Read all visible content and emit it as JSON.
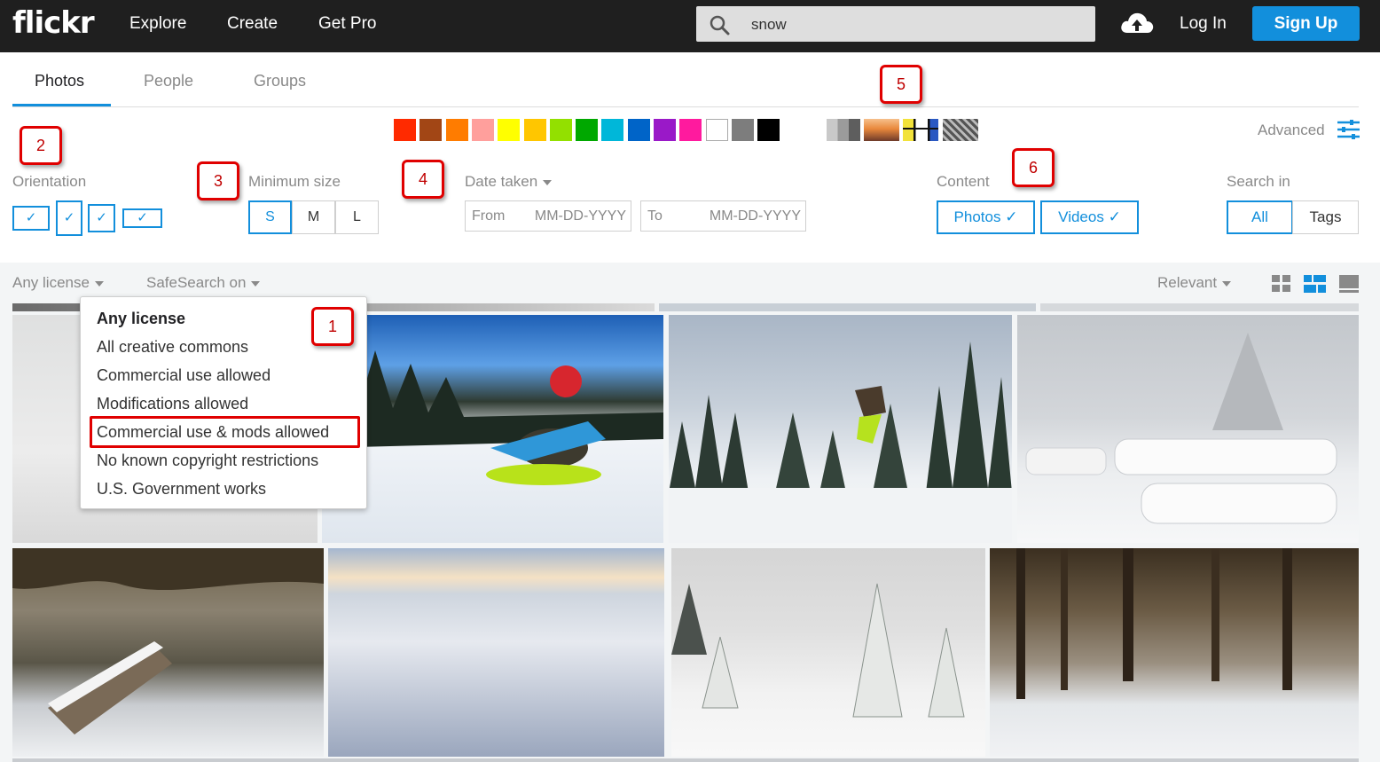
{
  "header": {
    "logo": "flickr",
    "nav": [
      "Explore",
      "Create",
      "Get Pro"
    ],
    "search_value": "snow",
    "login": "Log In",
    "signup": "Sign Up",
    "upload_icon": "cloud-upload-icon"
  },
  "tabs": [
    "Photos",
    "People",
    "Groups"
  ],
  "active_tab": "Photos",
  "colors": {
    "accent": "#128fdc",
    "header_bg": "#1f1f1f",
    "annotation": "#e00000",
    "swatches": [
      "#ff2a00",
      "#a24615",
      "#ff7c00",
      "#ff9f9c",
      "#ffff00",
      "#ffc600",
      "#93e000",
      "#00a800",
      "#00b7d9",
      "#0064c8",
      "#9a19c8",
      "#ff1a9e",
      "#ffffff",
      "#7d7d7d",
      "#000000"
    ]
  },
  "filters": {
    "advanced": "Advanced",
    "orientation_label": "Orientation",
    "min_size_label": "Minimum size",
    "sizes": [
      "S",
      "M",
      "L"
    ],
    "date_label": "Date taken",
    "from_label": "From",
    "to_label": "To",
    "date_placeholder": "MM-DD-YYYY",
    "content_label": "Content",
    "content_options": [
      "Photos ✓",
      "Videos ✓"
    ],
    "search_in_label": "Search in",
    "search_in_options": [
      "All",
      "Tags"
    ]
  },
  "toolbar": {
    "license": "Any license",
    "safesearch": "SafeSearch on",
    "sort": "Relevant"
  },
  "license_menu": [
    "Any license",
    "All creative commons",
    "Commercial use allowed",
    "Modifications allowed",
    "Commercial use & mods allowed",
    "No known copyright restrictions",
    "U.S. Government works"
  ],
  "annotations": [
    "1",
    "2",
    "3",
    "4",
    "5",
    "6"
  ]
}
